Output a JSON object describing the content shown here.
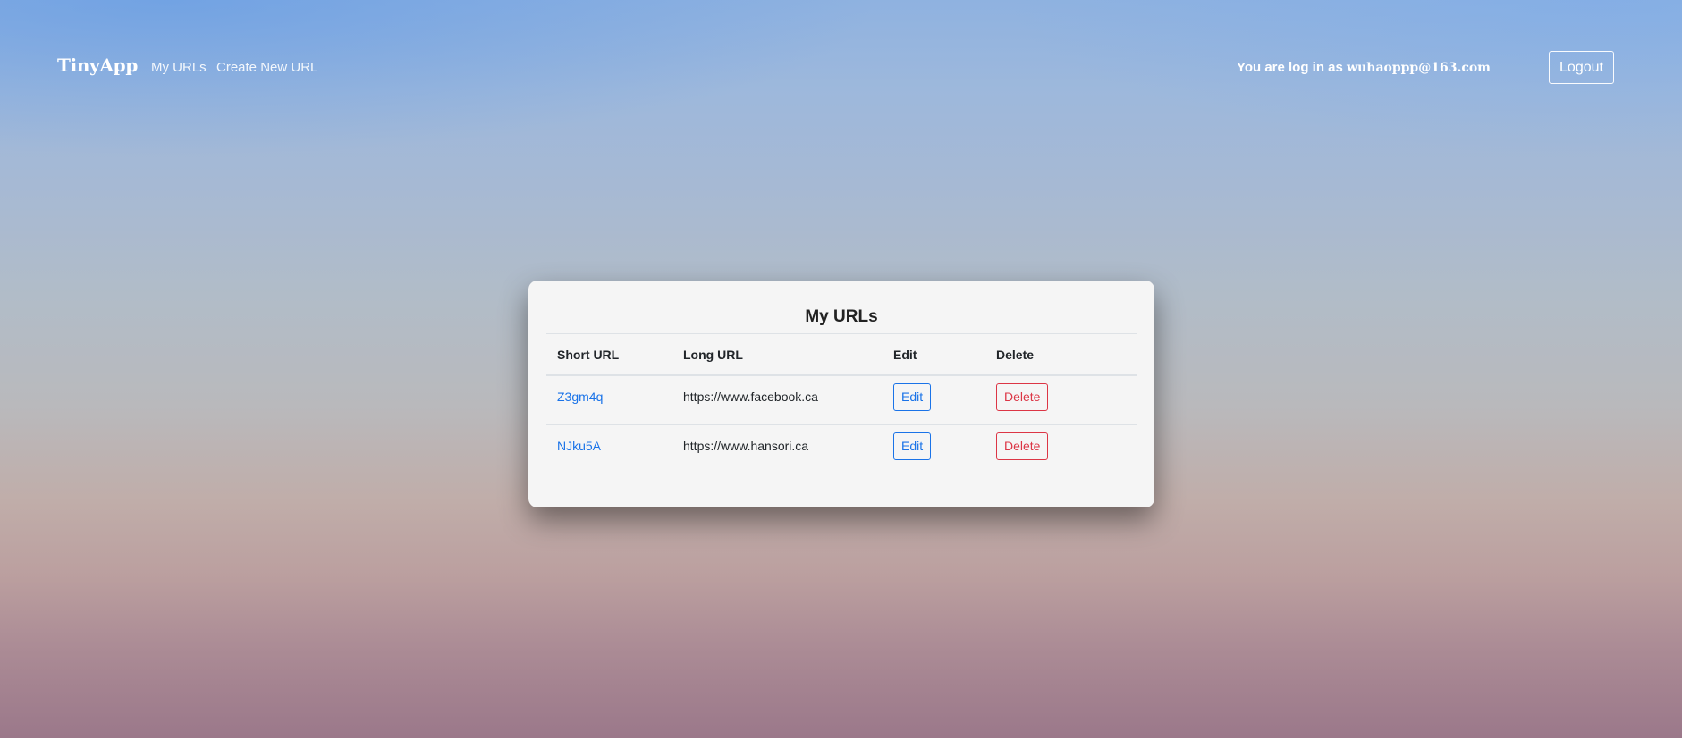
{
  "navbar": {
    "brand": "TinyApp",
    "links": [
      "My URLs",
      "Create New URL"
    ],
    "login_prefix": "You are log in as",
    "login_email": "wuhaoppp@163.com",
    "logout_label": "Logout"
  },
  "main": {
    "title": "My URLs",
    "columns": [
      "Short URL",
      "Long URL",
      "Edit",
      "Delete"
    ],
    "rows": [
      {
        "short_url": "Z3gm4q",
        "long_url": "https://www.facebook.ca",
        "edit_label": "Edit",
        "delete_label": "Delete"
      },
      {
        "short_url": "NJku5A",
        "long_url": "https://www.hansori.ca",
        "edit_label": "Edit",
        "delete_label": "Delete"
      }
    ]
  },
  "colors": {
    "link": "#1a73e8",
    "danger": "#dc3545",
    "card": "#f5f5f5"
  }
}
